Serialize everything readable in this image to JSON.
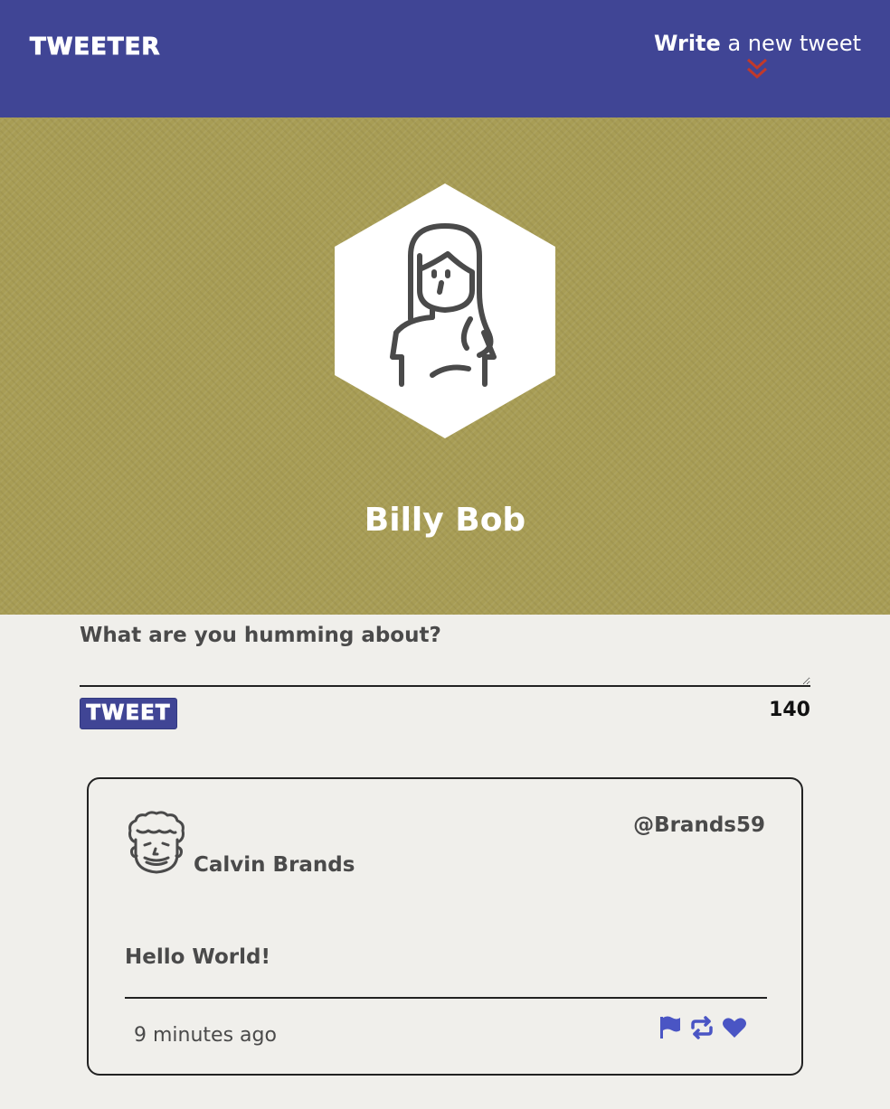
{
  "nav": {
    "brand": "TWEETER",
    "compose_bold": "Write",
    "compose_rest": " a new tweet"
  },
  "profile": {
    "name": "Billy Bob"
  },
  "new_tweet": {
    "label": "What are you humming about?",
    "placeholder": "",
    "button_label": "TWEET",
    "counter": "140"
  },
  "tweets": [
    {
      "author": "Calvin Brands",
      "handle": "@Brands59",
      "content": "Hello World!",
      "time": "9 minutes ago"
    }
  ],
  "colors": {
    "nav_bg": "#404595",
    "header_bg": "#a89d55",
    "page_bg": "#f0efeb",
    "accent_red": "#c0392b",
    "action_icons": "#4a55c4"
  },
  "icons": {
    "compose_arrow": "double-chevron-down-icon",
    "profile_avatar": "woman-avatar-icon",
    "tweet_avatar": "man-avatar-icon",
    "flag": "flag-icon",
    "retweet": "retweet-icon",
    "like": "heart-icon"
  }
}
